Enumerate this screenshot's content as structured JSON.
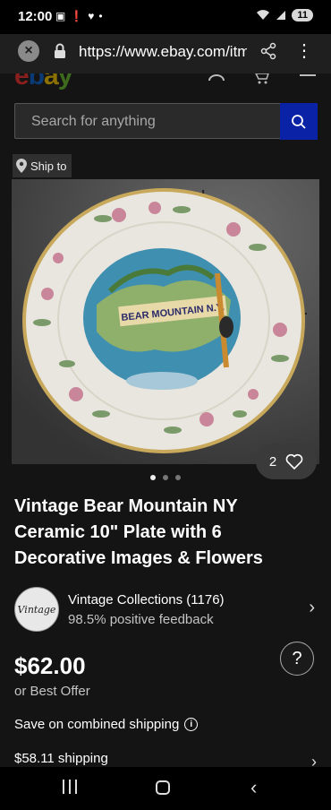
{
  "status_bar": {
    "time": "12:00",
    "notification_icons": [
      "screenshot-icon",
      "alert-icon",
      "messenger-icon",
      "dot-icon"
    ],
    "battery": "11"
  },
  "browser": {
    "url": "https://www.ebay.com/itm"
  },
  "header": {
    "logo_letters": [
      "e",
      "b",
      "a",
      "y"
    ]
  },
  "search": {
    "placeholder": "Search for anything"
  },
  "ship_to": {
    "label": "Ship to"
  },
  "gallery": {
    "dots": 3,
    "active_index": 0,
    "watch_count": "2"
  },
  "plate_image": {
    "center_text": "BEAR MOUNTAIN N.Y."
  },
  "listing": {
    "title": "Vintage Bear Mountain NY Ceramic 10\" Plate with 6 Decorative Images & Flowers",
    "seller_name": "Vintage Collections (1176)",
    "seller_feedback": "98.5% positive feedback",
    "seller_logo_text": "Vintage",
    "price": "$62.00",
    "offer": "or Best Offer",
    "combined_shipping": "Save on combined shipping",
    "shipping": "$58.11 shipping"
  },
  "colors": {
    "search_button": "#0a23a6",
    "background": "#141414"
  }
}
